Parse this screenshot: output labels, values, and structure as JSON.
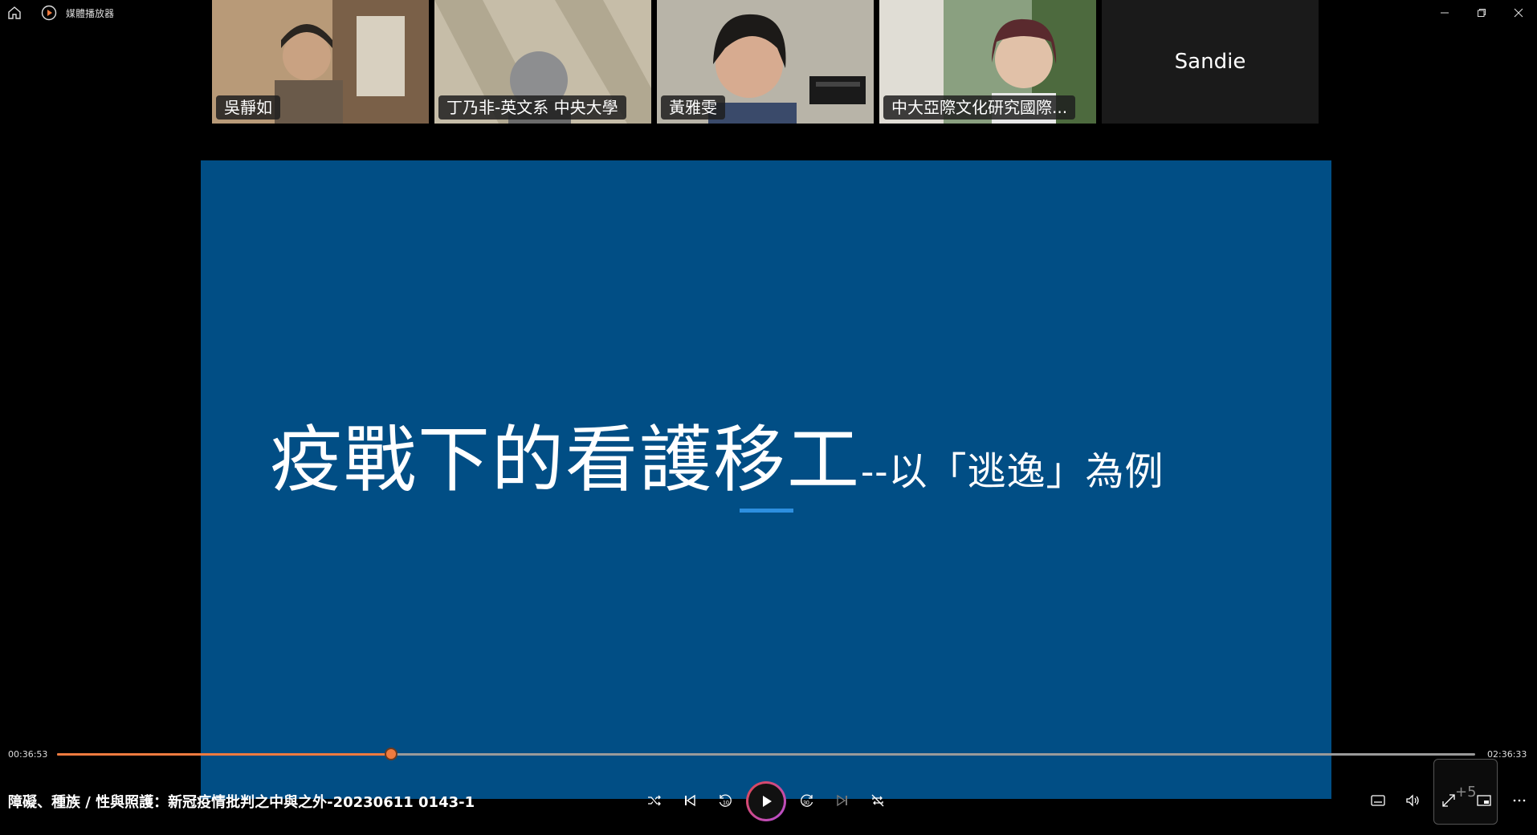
{
  "titlebar": {
    "app_name": "媒體播放器",
    "home_icon": "home-icon",
    "minimize_icon": "minimize-icon",
    "restore_icon": "restore-icon",
    "close_icon": "close-icon"
  },
  "participants": [
    {
      "name": "吳靜如",
      "color": "#6a5a4a"
    },
    {
      "name": "丁乃非-英文系 中央大學",
      "color": "#8d8470"
    },
    {
      "name": "黃雅雯",
      "color": "#8a8a86"
    },
    {
      "name": "中大亞際文化研究國際...",
      "color": "#5a6a4e"
    },
    {
      "name": "Sandie",
      "color": "#1a1a1a"
    }
  ],
  "slide": {
    "title_main": "疫戰下的看護移工",
    "title_sub": "--以「逃逸」為例",
    "background_color": "#014e85",
    "accent_color": "#2d8fe0"
  },
  "playback": {
    "current_time": "00:36:53",
    "total_time": "02:36:33",
    "progress": 0.2357,
    "accent_color": "#f07b3f",
    "seek_label": "+5"
  },
  "video": {
    "title": "障礙、種族 / 性與照護：新冠疫情批判之中與之外-20230611 0143-1"
  },
  "controls": {
    "shuffle_icon": "shuffle-icon",
    "previous_icon": "previous-icon",
    "rewind_icon": "rewind-10-icon",
    "play_icon": "play-icon",
    "forward_icon": "forward-30-icon",
    "next_icon": "next-icon",
    "repeat_icon": "repeat-off-icon",
    "captions_icon": "captions-icon",
    "volume_icon": "volume-icon",
    "fullscreen_icon": "fullscreen-icon",
    "miniplayer_icon": "miniplayer-icon",
    "more_icon": "more-icon"
  }
}
